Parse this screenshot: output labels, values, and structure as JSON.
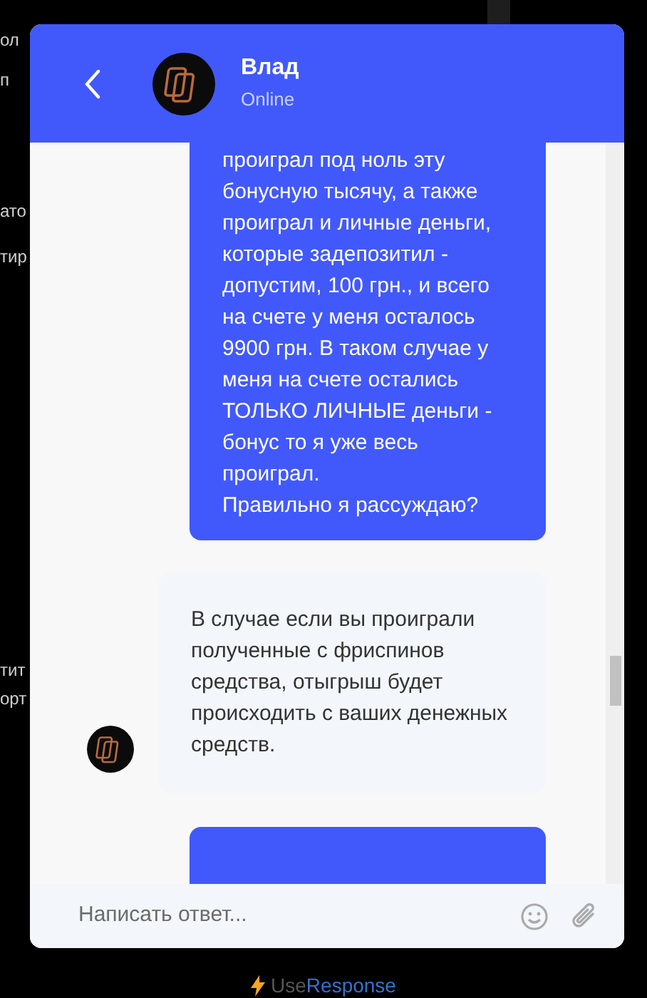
{
  "background_fragments": [
    "ол",
    "п",
    "ато",
    "тир",
    "тит",
    "орт"
  ],
  "header": {
    "name": "Влад",
    "status": "Online"
  },
  "messages": [
    {
      "kind": "outgoing",
      "text": "проиграл под ноль эту бонусную тысячу, а также проиграл и личные деньги, которые задепозитил - допустим, 100 грн., и всего на счете у меня осталось 9900 грн. В таком случае у меня на счете остались ТОЛЬКО ЛИЧНЫЕ деньги - бонус то я уже весь проиграл.\nПравильно я рассуждаю?"
    },
    {
      "kind": "incoming",
      "text": "В случае если вы проиграли полученные с фриспинов средства, отыгрыш будет происходить с ваших денежных средств."
    },
    {
      "kind": "outgoing"
    }
  ],
  "composer": {
    "placeholder": "Написать ответ..."
  },
  "footer": {
    "brand_prefix": "Use",
    "brand_name": "Response"
  }
}
